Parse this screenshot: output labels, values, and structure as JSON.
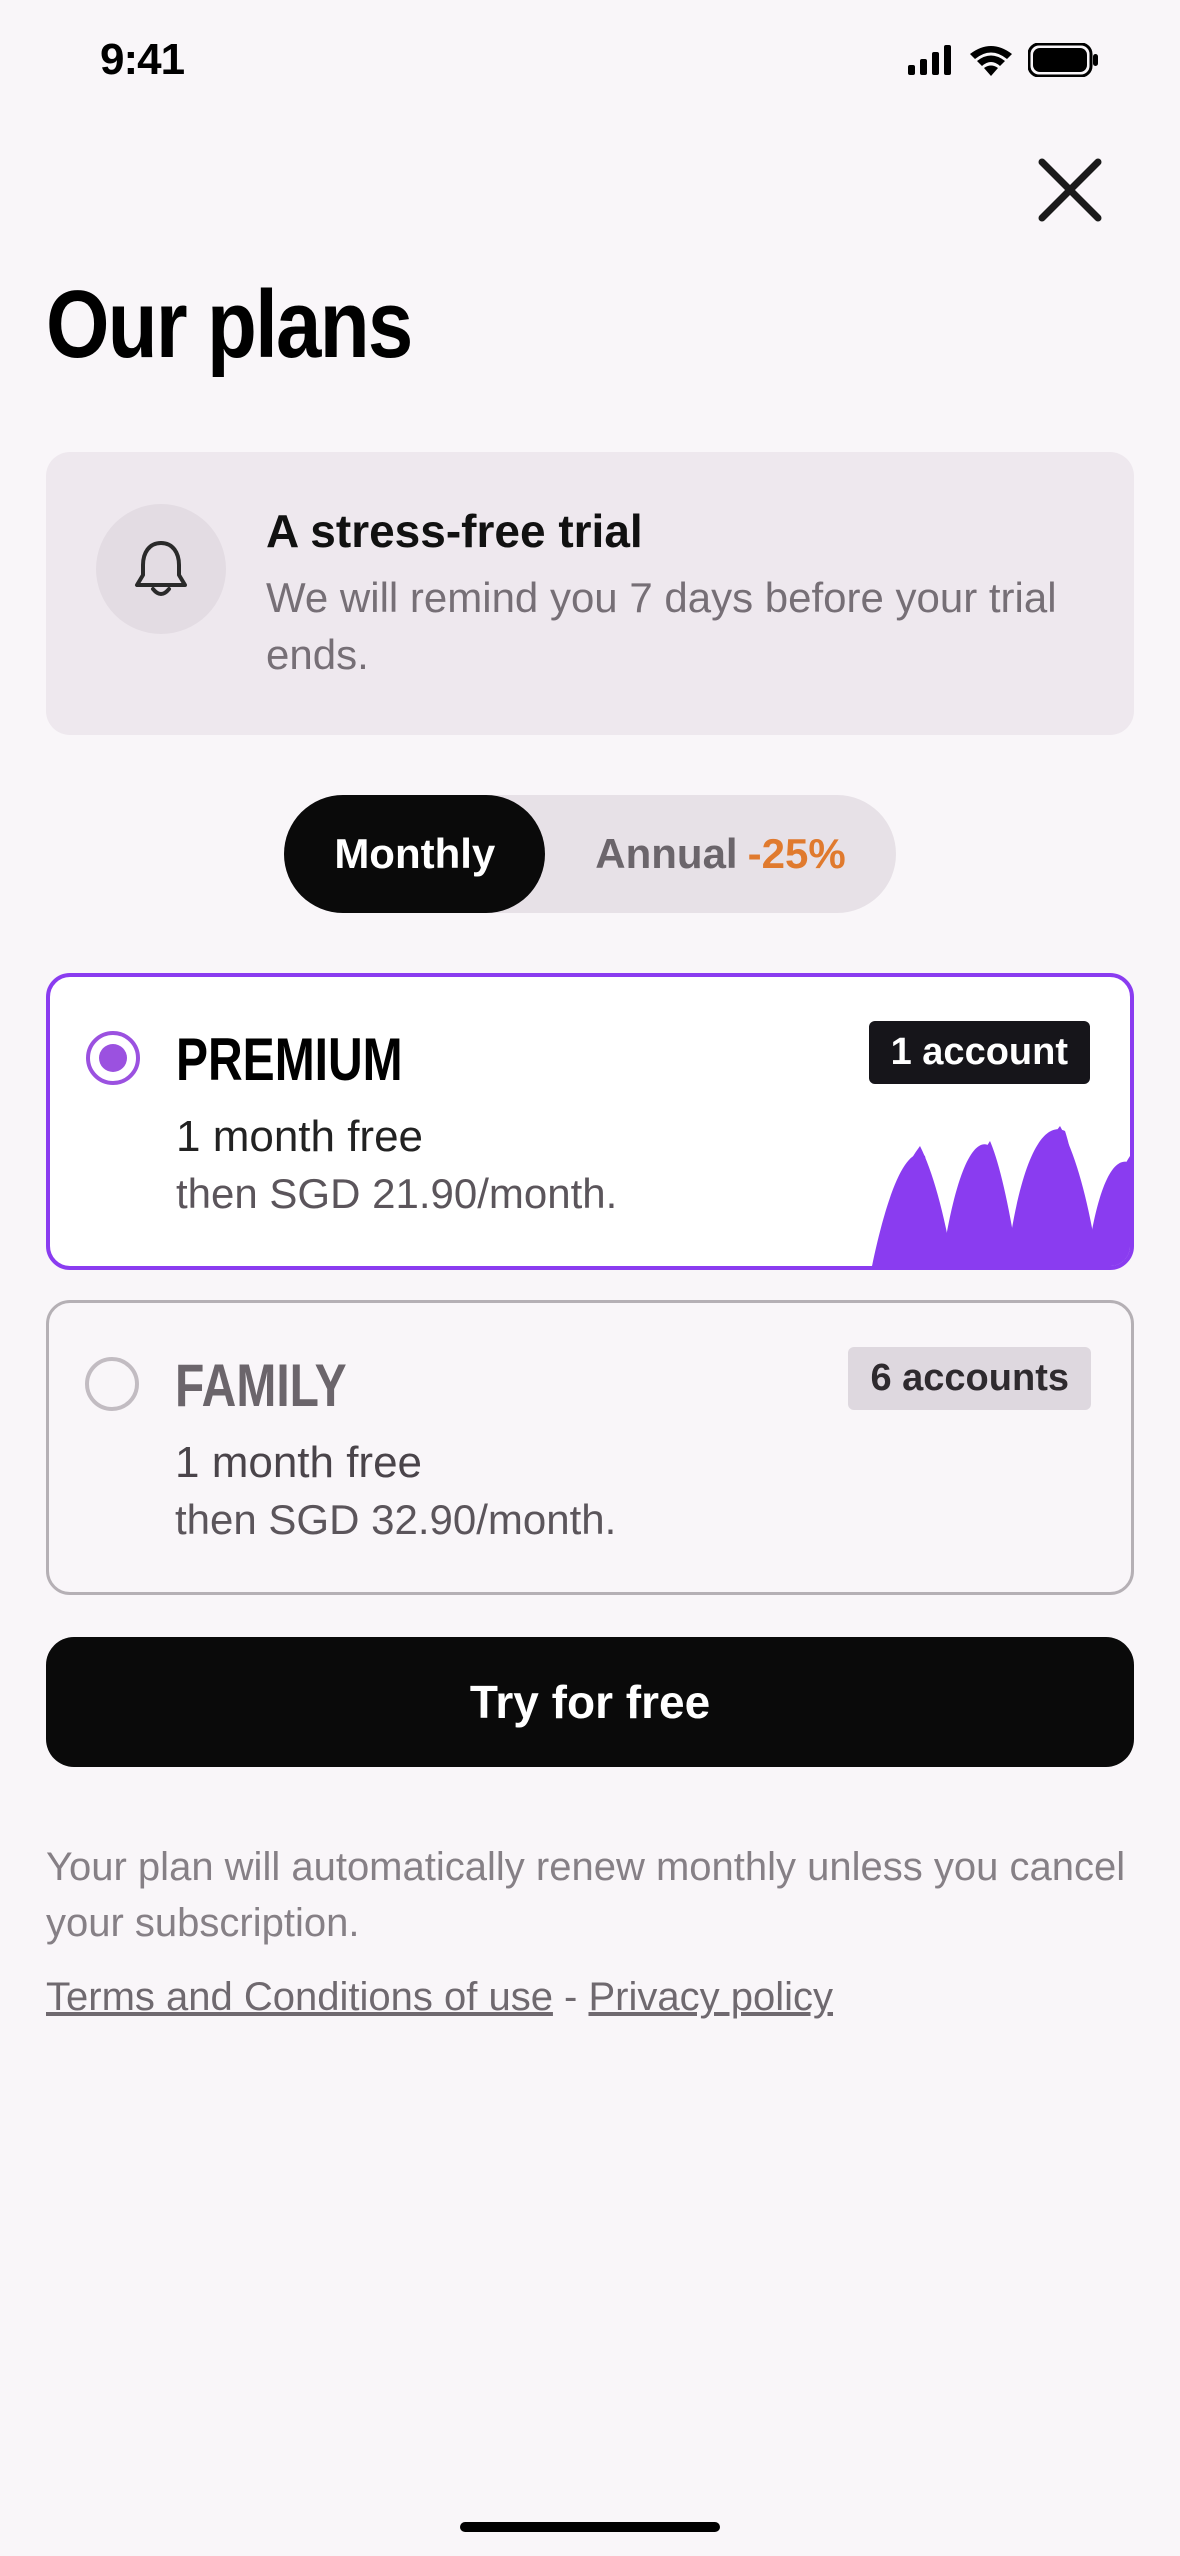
{
  "status": {
    "time": "9:41"
  },
  "header": {
    "title": "Our plans"
  },
  "info": {
    "title": "A stress-free trial",
    "desc": "We will remind you 7 days before your trial ends."
  },
  "toggle": {
    "monthly": "Monthly",
    "annual": "Annual",
    "annual_badge": "-25%"
  },
  "plans": {
    "premium": {
      "name": "PREMIUM",
      "trial": "1 month free",
      "price": "then SGD 21.90/month.",
      "badge": "1 account"
    },
    "family": {
      "name": "FAMILY",
      "trial": "1 month free",
      "price": "then SGD 32.90/month.",
      "badge": "6 accounts"
    }
  },
  "cta": {
    "label": "Try for free"
  },
  "disclaimer": "Your plan will automatically renew monthly unless you cancel your subscription.",
  "links": {
    "terms": "Terms and Conditions of use",
    "sep": " - ",
    "privacy": "Privacy policy"
  },
  "colors": {
    "accent": "#8a3cf0"
  }
}
